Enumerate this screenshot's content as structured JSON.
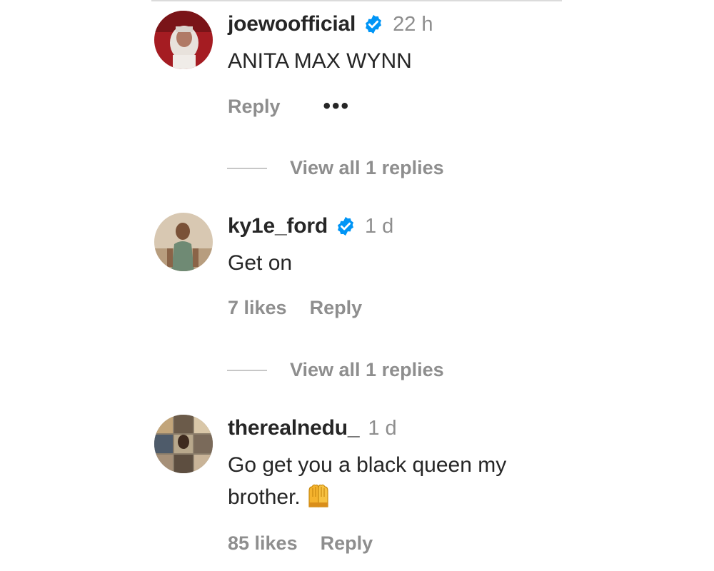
{
  "comments": [
    {
      "username": "joewoofficial",
      "verified": true,
      "time": "22 h",
      "text": "ANITA MAX WYNN",
      "likes": "",
      "reply_label": "Reply",
      "more_label": "•••",
      "view_replies": "View all 1 replies"
    },
    {
      "username": "ky1e_ford",
      "verified": true,
      "time": "1 d",
      "text": "Get on",
      "likes": "7 likes",
      "reply_label": "Reply",
      "view_replies": "View all 1 replies"
    },
    {
      "username": "therealnedu_",
      "verified": false,
      "time": "1 d",
      "text": "Go get you a black queen my brother.",
      "emoji": "raising-hands-emoji",
      "likes": "85 likes",
      "reply_label": "Reply"
    }
  ],
  "colors": {
    "primary_text": "#262626",
    "secondary_text": "#8e8e8e",
    "verified_blue": "#0095f6",
    "divider": "#dbdbdb"
  }
}
